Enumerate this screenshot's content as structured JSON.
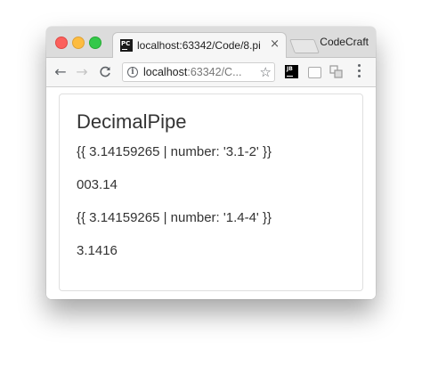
{
  "browser": {
    "tab": {
      "favicon_text": "PC",
      "title": "localhost:63342/Code/8.pi",
      "close_glyph": "×"
    },
    "profile_name": "CodeCraft",
    "address": {
      "host": "localhost",
      "rest": ":63342/C..."
    },
    "extensions": {
      "jb_text": "JB"
    },
    "icons": [
      "back-arrow-icon",
      "forward-arrow-icon",
      "reload-icon",
      "info-icon",
      "star-icon",
      "jetbrains-icon",
      "extension-box-icon",
      "puzzle-icon",
      "menu-icon"
    ]
  },
  "page": {
    "title": "DecimalPipe",
    "lines": [
      "{{ 3.14159265 | number: '3.1-2' }}",
      "003.14",
      "{{ 3.14159265 | number: '1.4-4' }}",
      "3.1416"
    ]
  }
}
